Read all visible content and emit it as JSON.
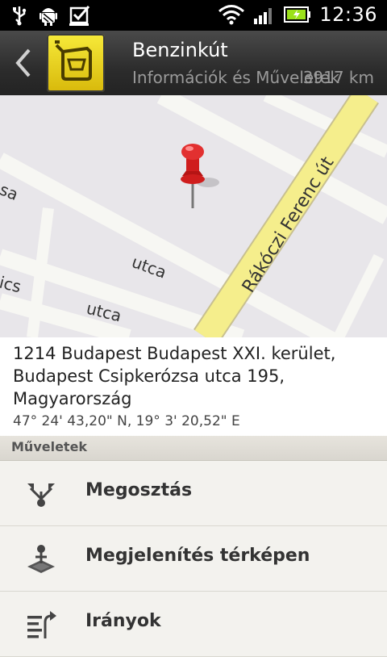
{
  "status_bar": {
    "time": "12:36",
    "icons": [
      "usb-icon",
      "android-debug-icon",
      "checkbox-icon",
      "wifi-icon",
      "signal-icon",
      "battery-charging-icon"
    ]
  },
  "header": {
    "title": "Benzinkút",
    "subtitle": "Információk és Műveletek",
    "distance": "3917 km",
    "back_icon": "back-arrow-icon",
    "app_icon": "fuel-can-icon",
    "accent": "#f0dd2a"
  },
  "map": {
    "street_labels": [
      "Rákóczi Ferenc út",
      "utca",
      "utca",
      "sa",
      "ics"
    ],
    "pin_color": "#d01d1d"
  },
  "address": {
    "line1": "1214  Budapest Budapest XXI. kerület,",
    "line2": "Budapest Csipkerózsa utca 195,",
    "line3": "Magyarország",
    "coordinates": "47° 24' 43,20\" N, 19° 3' 20,52\" E"
  },
  "actions": {
    "section_title": "Műveletek",
    "items": [
      {
        "label": "Megosztás",
        "icon": "share-icon"
      },
      {
        "label": "Megjelenítés térképen",
        "icon": "show-on-map-icon"
      },
      {
        "label": "Irányok",
        "icon": "directions-icon"
      }
    ]
  }
}
